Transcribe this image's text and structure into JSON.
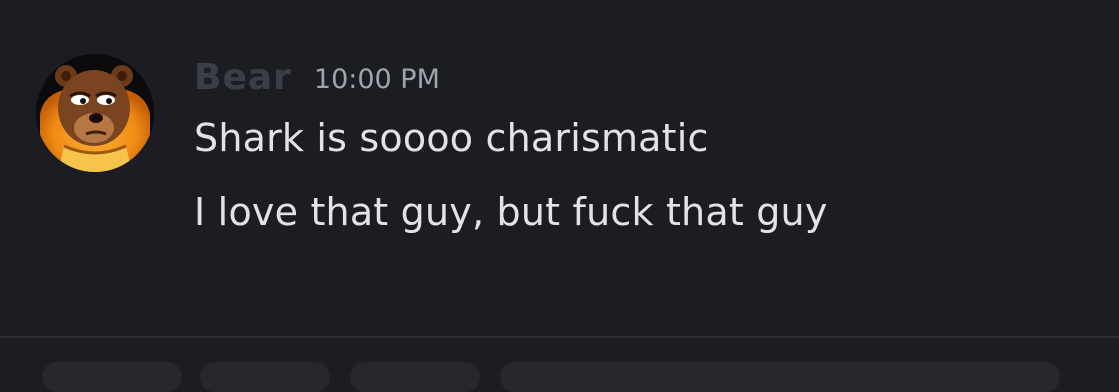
{
  "message": {
    "username": "Bear",
    "timestamp": "10:00 PM",
    "lines": [
      "Shark is soooo charismatic",
      "I love that guy, but fuck that guy"
    ]
  },
  "avatar": {
    "icon": "bear-avatar-icon"
  },
  "colors": {
    "background": "#1c1d22",
    "username": "#3a3f47",
    "timestamp": "#a0a4ad",
    "text": "#e2e3e6",
    "avatar_accent": "#f29a1c"
  }
}
